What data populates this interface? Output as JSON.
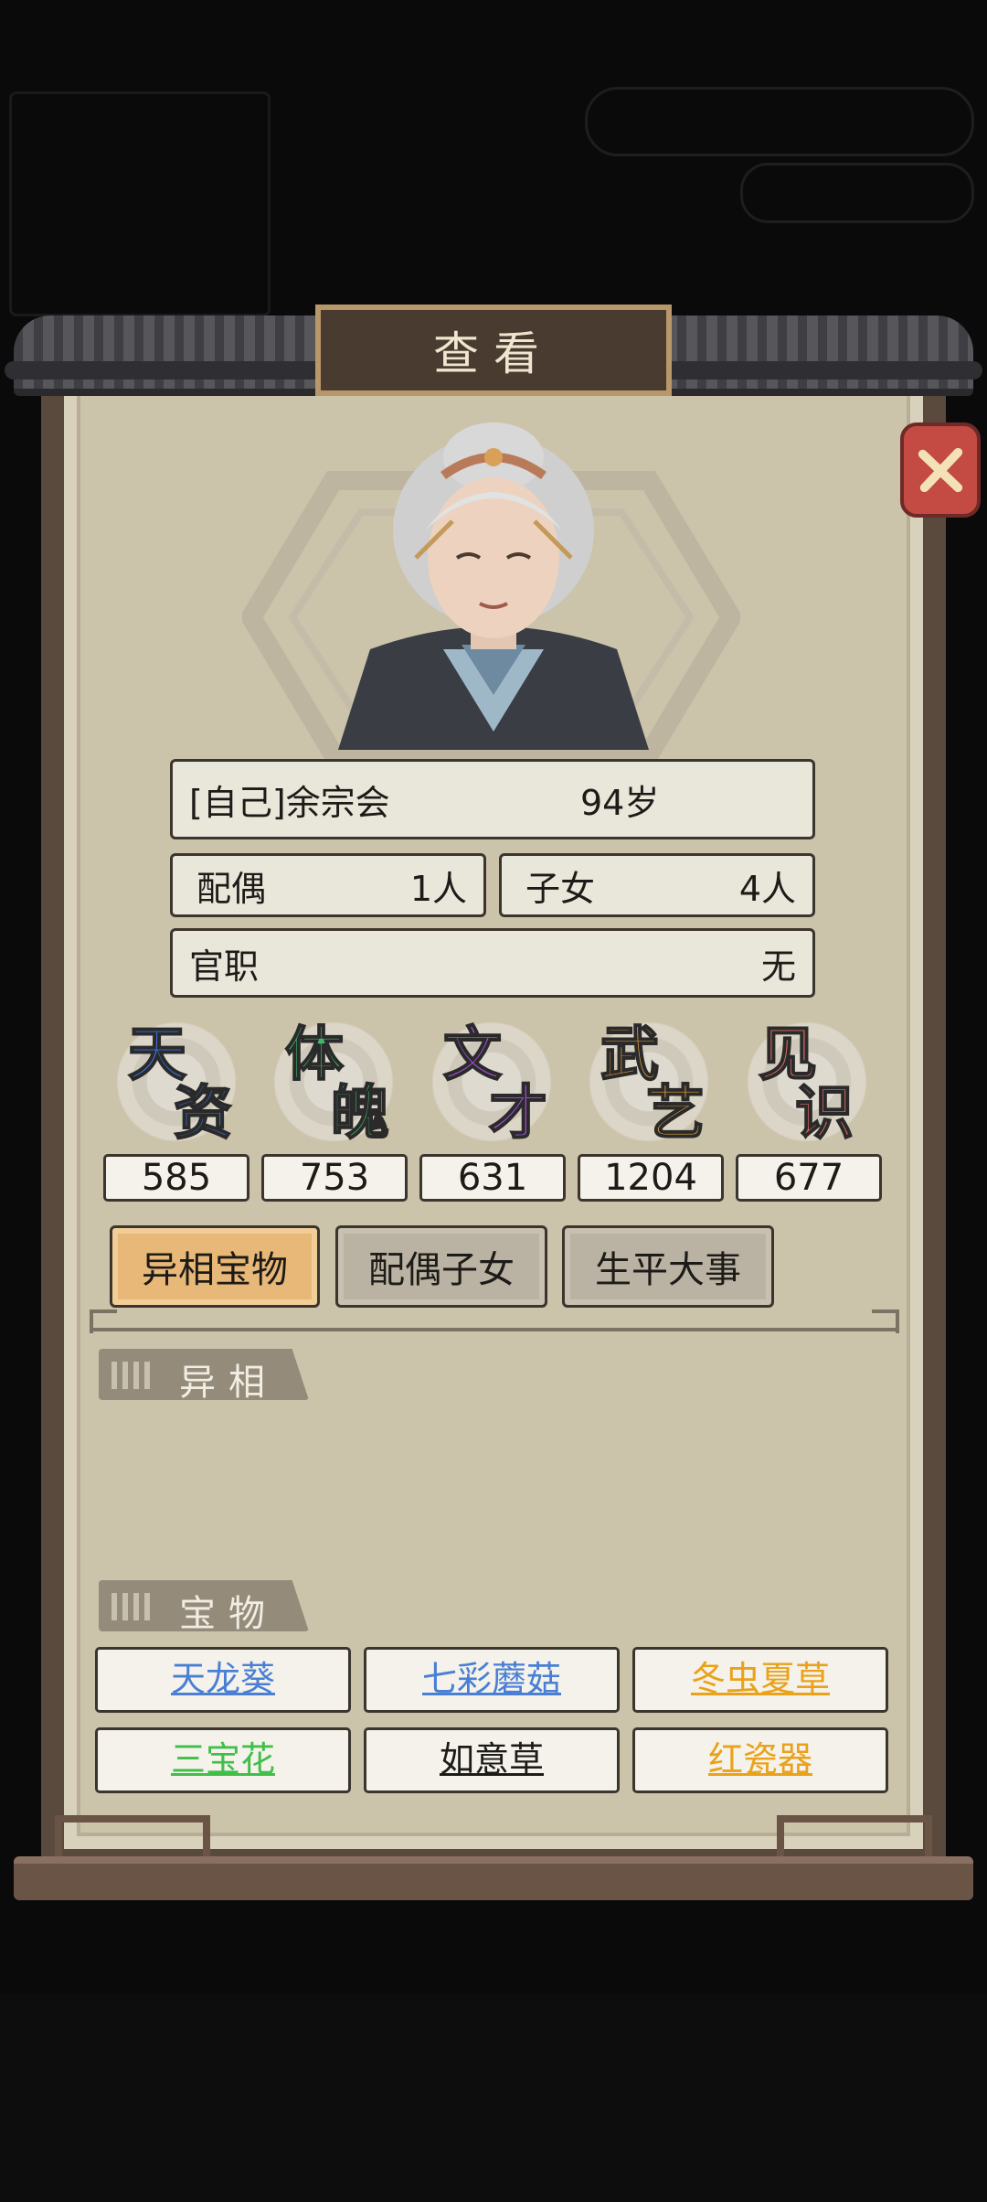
{
  "dialog": {
    "title": "查看"
  },
  "profile": {
    "name": "[自己]余宗会",
    "age": "94岁",
    "spouse_label": "配偶",
    "spouse_value": "1人",
    "children_label": "子女",
    "children_value": "4人",
    "office_label": "官职",
    "office_value": "无"
  },
  "attributes": [
    {
      "name_top": "天",
      "name_bottom": "资",
      "value": "585",
      "color": "#3d6fe0"
    },
    {
      "name_top": "体",
      "name_bottom": "魄",
      "value": "753",
      "color": "#3fb86a"
    },
    {
      "name_top": "文",
      "name_bottom": "才",
      "value": "631",
      "color": "#a84fd8"
    },
    {
      "name_top": "武",
      "name_bottom": "艺",
      "value": "1204",
      "color": "#e6a23c"
    },
    {
      "name_top": "见",
      "name_bottom": "识",
      "value": "677",
      "color": "#e07064"
    }
  ],
  "tabs": [
    {
      "label": "异相宝物",
      "active": true
    },
    {
      "label": "配偶子女",
      "active": false
    },
    {
      "label": "生平大事",
      "active": false
    }
  ],
  "sections": {
    "traits_title": "异相",
    "treasures_title": "宝物"
  },
  "treasures": [
    {
      "label": "天龙葵",
      "color": "#4a7fd6"
    },
    {
      "label": "七彩蘑菇",
      "color": "#4a7fd6"
    },
    {
      "label": "冬虫夏草",
      "color": "#e9a21a"
    },
    {
      "label": "三宝花",
      "color": "#3fbf4a"
    },
    {
      "label": "如意草",
      "color": "#1d1b18"
    },
    {
      "label": "红瓷器",
      "color": "#e9a21a"
    }
  ],
  "icons": {
    "close": "close-x-icon"
  }
}
